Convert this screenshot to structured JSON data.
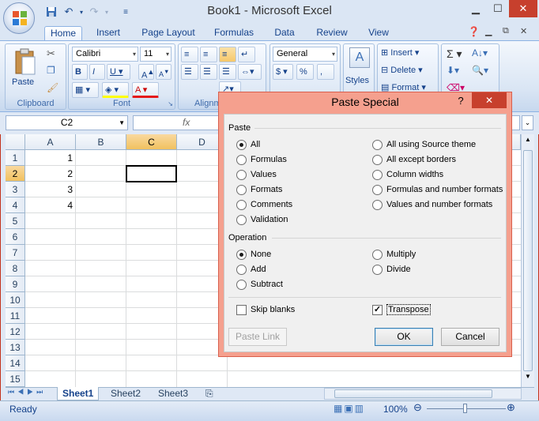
{
  "app": {
    "title": "Book1 - Microsoft Excel"
  },
  "ribbon_tabs": [
    "Home",
    "Insert",
    "Page Layout",
    "Formulas",
    "Data",
    "Review",
    "View"
  ],
  "ribbon": {
    "clipboard": {
      "label": "Clipboard",
      "paste": "Paste"
    },
    "font": {
      "label": "Font",
      "font_name": "Calibri",
      "font_size": "11"
    },
    "alignment": {
      "label": "Alignm"
    },
    "number": {
      "format": "General"
    },
    "styles": {
      "label": "Styles"
    },
    "cells": {
      "insert": "Insert",
      "delete": "Delete",
      "format": "Format"
    }
  },
  "formula_bar": {
    "name_box": "C2",
    "fx": "fx",
    "content": ""
  },
  "columns": [
    "A",
    "B",
    "C",
    "D"
  ],
  "rows": [
    "1",
    "2",
    "3",
    "4",
    "5",
    "6",
    "7",
    "8",
    "9",
    "10",
    "11",
    "12",
    "13",
    "14",
    "15"
  ],
  "cells": {
    "A1": "1",
    "A2": "2",
    "A3": "3",
    "A4": "4"
  },
  "selected_cell": "C2",
  "sheets": [
    "Sheet1",
    "Sheet2",
    "Sheet3"
  ],
  "status": {
    "left": "Ready",
    "zoom": "100%"
  },
  "dialog": {
    "title": "Paste Special",
    "help": "?",
    "close": "✕",
    "paste_section": "Paste",
    "paste_options_left": [
      "All",
      "Formulas",
      "Values",
      "Formats",
      "Comments",
      "Validation"
    ],
    "paste_options_right": [
      "All using Source theme",
      "All except borders",
      "Column widths",
      "Formulas and number formats",
      "Values and number formats"
    ],
    "paste_selected": "All",
    "operation_section": "Operation",
    "operation_options_left": [
      "None",
      "Add",
      "Subtract"
    ],
    "operation_options_right": [
      "Multiply",
      "Divide"
    ],
    "operation_selected": "None",
    "skip_blanks": "Skip blanks",
    "skip_blanks_checked": false,
    "transpose": "Transpose",
    "transpose_checked": true,
    "paste_link": "Paste Link",
    "ok": "OK",
    "cancel": "Cancel"
  }
}
